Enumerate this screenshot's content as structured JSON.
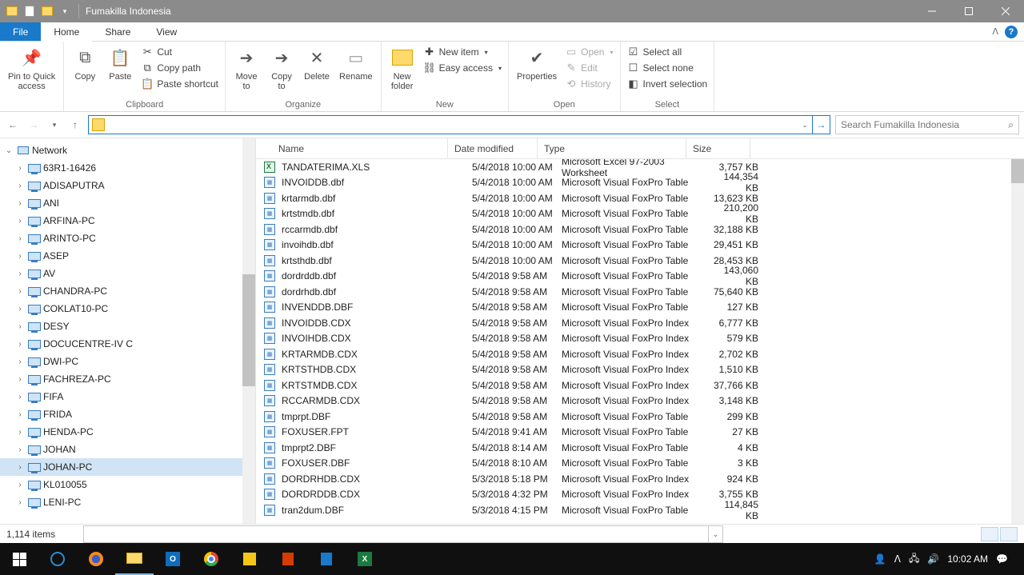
{
  "titlebar": {
    "title": "Fumakilla Indonesia"
  },
  "tabs": {
    "file": "File",
    "home": "Home",
    "share": "Share",
    "view": "View"
  },
  "ribbon": {
    "pin": "Pin to Quick\naccess",
    "copy": "Copy",
    "paste": "Paste",
    "cut": "Cut",
    "copypath": "Copy path",
    "pastesc": "Paste shortcut",
    "clipboard": "Clipboard",
    "moveto": "Move\nto",
    "copyto": "Copy\nto",
    "delete": "Delete",
    "rename": "Rename",
    "organize": "Organize",
    "newfolder": "New\nfolder",
    "newitem": "New item",
    "easyaccess": "Easy access",
    "new": "New",
    "properties": "Properties",
    "open_item": "Open",
    "edit": "Edit",
    "history": "History",
    "open": "Open",
    "selectall": "Select all",
    "selectnone": "Select none",
    "invert": "Invert selection",
    "select": "Select"
  },
  "search": {
    "placeholder": "Search Fumakilla Indonesia"
  },
  "tree": {
    "root": "Network",
    "items": [
      "63R1-16426",
      "ADISAPUTRA",
      "ANI",
      "ARFINA-PC",
      "ARINTO-PC",
      "ASEP",
      "AV",
      "CHANDRA-PC",
      "COKLAT10-PC",
      "DESY",
      "DOCUCENTRE-IV C",
      "DWI-PC",
      "FACHREZA-PC",
      "FIFA",
      "FRIDA",
      "HENDA-PC",
      "JOHAN",
      "JOHAN-PC",
      "KL010055",
      "LENI-PC"
    ],
    "selected": 17
  },
  "columns": {
    "name": "Name",
    "date": "Date modified",
    "type": "Type",
    "size": "Size"
  },
  "files": [
    {
      "name": "TANDATERIMA.XLS",
      "date": "5/4/2018 10:00 AM",
      "type": "Microsoft Excel 97-2003 Worksheet",
      "size": "3,757 KB",
      "icon": "xls"
    },
    {
      "name": "INVOIDDB.dbf",
      "date": "5/4/2018 10:00 AM",
      "type": "Microsoft Visual FoxPro Table",
      "size": "144,354 KB",
      "icon": "dbf"
    },
    {
      "name": "krtarmdb.dbf",
      "date": "5/4/2018 10:00 AM",
      "type": "Microsoft Visual FoxPro Table",
      "size": "13,623 KB",
      "icon": "dbf"
    },
    {
      "name": "krtstmdb.dbf",
      "date": "5/4/2018 10:00 AM",
      "type": "Microsoft Visual FoxPro Table",
      "size": "210,200 KB",
      "icon": "dbf"
    },
    {
      "name": "rccarmdb.dbf",
      "date": "5/4/2018 10:00 AM",
      "type": "Microsoft Visual FoxPro Table",
      "size": "32,188 KB",
      "icon": "dbf"
    },
    {
      "name": "invoihdb.dbf",
      "date": "5/4/2018 10:00 AM",
      "type": "Microsoft Visual FoxPro Table",
      "size": "29,451 KB",
      "icon": "dbf"
    },
    {
      "name": "krtsthdb.dbf",
      "date": "5/4/2018 10:00 AM",
      "type": "Microsoft Visual FoxPro Table",
      "size": "28,453 KB",
      "icon": "dbf"
    },
    {
      "name": "dordrddb.dbf",
      "date": "5/4/2018 9:58 AM",
      "type": "Microsoft Visual FoxPro Table",
      "size": "143,060 KB",
      "icon": "dbf"
    },
    {
      "name": "dordrhdb.dbf",
      "date": "5/4/2018 9:58 AM",
      "type": "Microsoft Visual FoxPro Table",
      "size": "75,640 KB",
      "icon": "dbf"
    },
    {
      "name": "INVENDDB.DBF",
      "date": "5/4/2018 9:58 AM",
      "type": "Microsoft Visual FoxPro Table",
      "size": "127 KB",
      "icon": "dbf"
    },
    {
      "name": "INVOIDDB.CDX",
      "date": "5/4/2018 9:58 AM",
      "type": "Microsoft Visual FoxPro Index",
      "size": "6,777 KB",
      "icon": "dbf"
    },
    {
      "name": "INVOIHDB.CDX",
      "date": "5/4/2018 9:58 AM",
      "type": "Microsoft Visual FoxPro Index",
      "size": "579 KB",
      "icon": "dbf"
    },
    {
      "name": "KRTARMDB.CDX",
      "date": "5/4/2018 9:58 AM",
      "type": "Microsoft Visual FoxPro Index",
      "size": "2,702 KB",
      "icon": "dbf"
    },
    {
      "name": "KRTSTHDB.CDX",
      "date": "5/4/2018 9:58 AM",
      "type": "Microsoft Visual FoxPro Index",
      "size": "1,510 KB",
      "icon": "dbf"
    },
    {
      "name": "KRTSTMDB.CDX",
      "date": "5/4/2018 9:58 AM",
      "type": "Microsoft Visual FoxPro Index",
      "size": "37,766 KB",
      "icon": "dbf"
    },
    {
      "name": "RCCARMDB.CDX",
      "date": "5/4/2018 9:58 AM",
      "type": "Microsoft Visual FoxPro Index",
      "size": "3,148 KB",
      "icon": "dbf"
    },
    {
      "name": "tmprpt.DBF",
      "date": "5/4/2018 9:58 AM",
      "type": "Microsoft Visual FoxPro Table",
      "size": "299 KB",
      "icon": "dbf"
    },
    {
      "name": "FOXUSER.FPT",
      "date": "5/4/2018 9:41 AM",
      "type": "Microsoft Visual FoxPro Table",
      "size": "27 KB",
      "icon": "dbf"
    },
    {
      "name": "tmprpt2.DBF",
      "date": "5/4/2018 8:14 AM",
      "type": "Microsoft Visual FoxPro Table",
      "size": "4 KB",
      "icon": "dbf"
    },
    {
      "name": "FOXUSER.DBF",
      "date": "5/4/2018 8:10 AM",
      "type": "Microsoft Visual FoxPro Table",
      "size": "3 KB",
      "icon": "dbf"
    },
    {
      "name": "DORDRHDB.CDX",
      "date": "5/3/2018 5:18 PM",
      "type": "Microsoft Visual FoxPro Index",
      "size": "924 KB",
      "icon": "dbf"
    },
    {
      "name": "DORDRDDB.CDX",
      "date": "5/3/2018 4:32 PM",
      "type": "Microsoft Visual FoxPro Index",
      "size": "3,755 KB",
      "icon": "dbf"
    },
    {
      "name": "tran2dum.DBF",
      "date": "5/3/2018 4:15 PM",
      "type": "Microsoft Visual FoxPro Table",
      "size": "114,845 KB",
      "icon": "dbf"
    }
  ],
  "status": {
    "items": "1,114 items"
  },
  "tray": {
    "time": "10:02 AM"
  }
}
